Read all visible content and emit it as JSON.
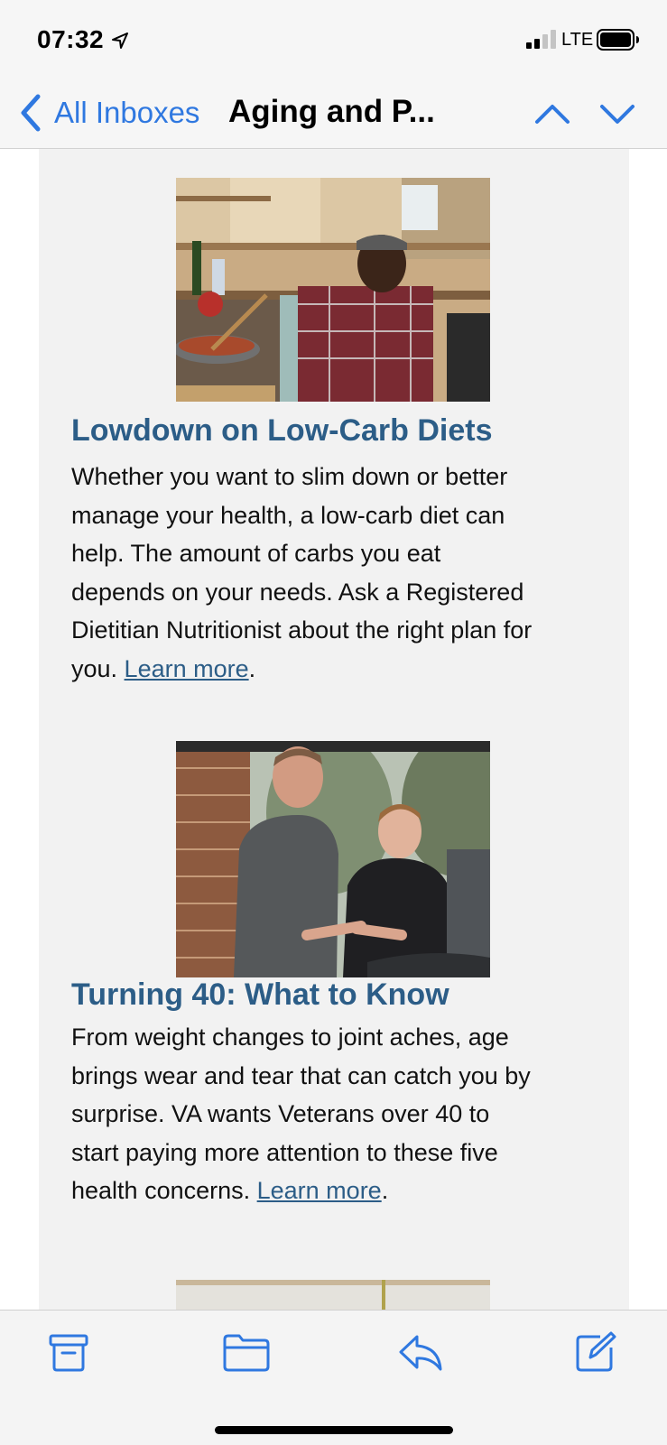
{
  "status_bar": {
    "time": "07:32",
    "network": "LTE",
    "icons": [
      "location-arrow-icon",
      "cellular-signal-icon",
      "battery-icon"
    ]
  },
  "nav": {
    "back_label": "All Inboxes",
    "title": "Aging and P...",
    "icons": [
      "chevron-left-icon",
      "chevron-up-icon",
      "chevron-down-icon"
    ]
  },
  "articles": [
    {
      "title": "Lowdown on Low-Carb Diets",
      "body_lines": [
        "Whether you want to slim down or better",
        "manage your health, a low-carb diet can",
        "help. The amount of carbs you eat",
        "depends on your needs. Ask a Registered",
        "Dietitian Nutritionist about the right plan for"
      ],
      "last_line_prefix": "you. ",
      "link_label": "Learn more",
      "last_line_suffix": "."
    },
    {
      "title": "Turning 40: What to Know",
      "body_lines": [
        "From weight changes to joint aches, age",
        "brings wear and tear that can catch you by",
        "surprise. VA wants Veterans over 40 to",
        "start paying more attention to these five"
      ],
      "last_line_prefix": "health concerns. ",
      "link_label": "Learn more",
      "last_line_suffix": "."
    }
  ],
  "toolbar": {
    "icons": [
      "archive-icon",
      "folder-icon",
      "reply-icon",
      "compose-icon"
    ]
  },
  "colors": {
    "accent": "#2f78e0",
    "headline": "#2c5d87",
    "card_background": "#f2f2f2"
  }
}
